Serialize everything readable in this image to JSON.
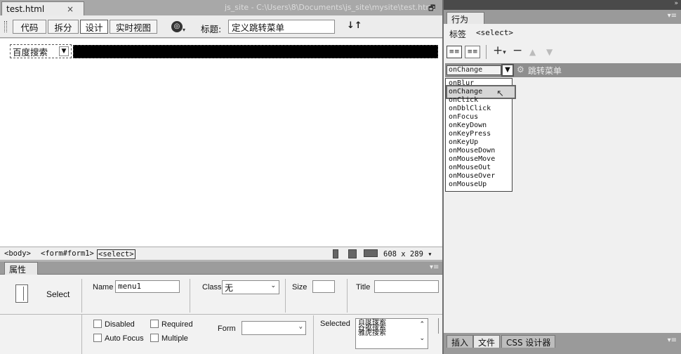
{
  "doc_tab": {
    "name": "test.html",
    "close": "×"
  },
  "window_path": "js_site - C:\\Users\\8\\Documents\\js_site\\mysite\\test.html",
  "toolbar": {
    "code": "代码",
    "split": "拆分",
    "design": "设计",
    "live": "实时视图",
    "title_label": "标题:",
    "title_value": "定义跳转菜单"
  },
  "design_view": {
    "select_text": "百度搜索"
  },
  "status": {
    "tags": [
      "<body>",
      "<form#form1>",
      "<select>"
    ],
    "dimensions": "608 x 289"
  },
  "properties": {
    "tab": "属性",
    "element_type": "Select",
    "name_label": "Name",
    "name_value": "menu1",
    "class_label": "Class",
    "class_value": "无",
    "size_label": "Size",
    "title_label": "Title",
    "disabled": "Disabled",
    "required": "Required",
    "autofocus": "Auto Focus",
    "multiple": "Multiple",
    "form_label": "Form",
    "selected_label": "Selected",
    "selected_options": [
      "百度搜索",
      "谷歌搜索",
      "雅虎搜索"
    ]
  },
  "behaviors": {
    "tab": "行为",
    "tag_label": "标签",
    "tag_value": "<select>",
    "current_event": "onChange",
    "action": "跳转菜单",
    "events": [
      "onBlur",
      "onChange",
      "onClick",
      "onDblClick",
      "onFocus",
      "onKeyDown",
      "onKeyPress",
      "onKeyUp",
      "onMouseDown",
      "onMouseMove",
      "onMouseOut",
      "onMouseOver",
      "onMouseUp"
    ]
  },
  "bottom_tabs": [
    "插入",
    "文件",
    "CSS 设计器"
  ]
}
